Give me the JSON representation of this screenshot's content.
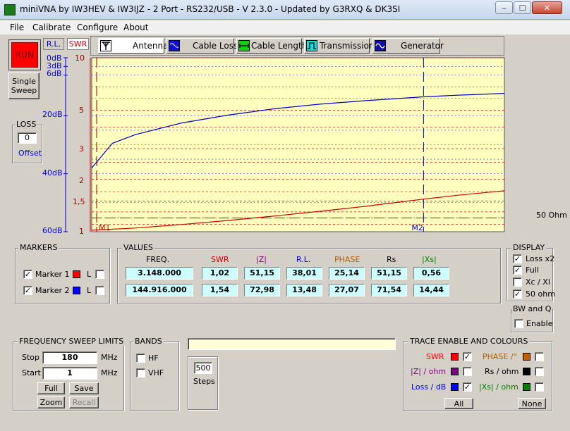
{
  "window": {
    "title": "miniVNA by IW3HEV & IW3IJZ - 2 Port - RS232/USB - V 2.3.0 - Updated by G3RXQ & DK3SI"
  },
  "menu": [
    "File",
    "Calibrate",
    "Configure",
    "About"
  ],
  "controls": {
    "run_label": "RUN",
    "single_sweep_label": "Single Sweep"
  },
  "loss": {
    "title": "LOSS",
    "value": "0",
    "offset_label": "Offset"
  },
  "axis_tabs": {
    "rl": "R.L.",
    "swr": "SWR"
  },
  "mode_tabs": [
    {
      "label": "Antenna",
      "icon": "antenna-icon"
    },
    {
      "label": "Cable Loss",
      "icon": "cable-loss-icon"
    },
    {
      "label": "Cable Length",
      "icon": "cable-length-icon"
    },
    {
      "label": "Transmission",
      "icon": "transmission-icon"
    },
    {
      "label": "Generator",
      "icon": "generator-icon"
    }
  ],
  "chart_data": {
    "type": "line",
    "rl_ticks": [
      "0dB",
      "3dB",
      "6dB",
      "20dB",
      "40dB",
      "60dB"
    ],
    "swr_ticks": [
      "10",
      "5",
      "3",
      "2",
      "1,5",
      "1"
    ],
    "impedance_label": "50 Ohm",
    "markers": [
      "M1",
      "M2"
    ],
    "x_range_mhz": [
      1,
      180
    ],
    "series": [
      {
        "name": "R.L.",
        "color": "#0000cc",
        "x": [
          1,
          10,
          20,
          40,
          60,
          80,
          100,
          120,
          144.9,
          160,
          180
        ],
        "y": [
          38.01,
          29.5,
          26.5,
          22.5,
          19.8,
          17.6,
          16.0,
          14.8,
          13.48,
          12.9,
          12.3
        ]
      },
      {
        "name": "SWR",
        "color": "#cc0000",
        "x": [
          1,
          20,
          40,
          60,
          80,
          100,
          120,
          144.9,
          160,
          180
        ],
        "y": [
          1.02,
          1.05,
          1.1,
          1.16,
          1.23,
          1.31,
          1.4,
          1.54,
          1.62,
          1.72
        ]
      }
    ]
  },
  "markers_panel": {
    "title": "MARKERS",
    "items": [
      {
        "label": "Marker 1",
        "checked": "✓",
        "color": "#ff0000",
        "l": "L"
      },
      {
        "label": "Marker 2",
        "checked": "✓",
        "color": "#0000ff",
        "l": "L"
      }
    ]
  },
  "values_panel": {
    "title": "VALUES",
    "headers": [
      "FREQ.",
      "SWR",
      "|Z|",
      "R.L.",
      "PHASE",
      "Rs",
      "|Xs|"
    ],
    "rows": [
      [
        "3.148.000",
        "1,02",
        "51,15",
        "38,01",
        "25,14",
        "51,15",
        "0,56"
      ],
      [
        "144.916.000",
        "1,54",
        "72,98",
        "13,48",
        "27,07",
        "71,54",
        "14,44"
      ]
    ]
  },
  "display_panel": {
    "title": "DISPLAY",
    "items": [
      {
        "label": "Loss x2",
        "checked": "✓"
      },
      {
        "label": "Full",
        "checked": "✓"
      },
      {
        "label": "Xc / Xl",
        "checked": ""
      },
      {
        "label": "50 ohm",
        "checked": "✓"
      }
    ]
  },
  "bwq_panel": {
    "title": "BW and Q",
    "enable_label": "Enable",
    "checked": ""
  },
  "sweep_panel": {
    "title": "FREQUENCY SWEEP LIMITS",
    "stop_label": "Stop",
    "stop_value": "180",
    "stop_unit": "MHz",
    "start_label": "Start",
    "start_value": "1",
    "start_unit": "MHz",
    "full_btn": "Full",
    "save_btn": "Save",
    "zoom_btn": "Zoom",
    "recall_btn": "Recall"
  },
  "bands_panel": {
    "title": "BANDS",
    "hf": "HF",
    "vhf": "VHF"
  },
  "steps": {
    "value": "500",
    "label": "Steps"
  },
  "trace_panel": {
    "title": "TRACE ENABLE AND COLOURS",
    "left": [
      {
        "label": "SWR",
        "color": "#ff0000",
        "label_color": "#ff0000",
        "checked": "✓"
      },
      {
        "label": "|Z| / ohm",
        "color": "#800080",
        "label_color": "#800080",
        "checked": ""
      },
      {
        "label": "Loss / dB",
        "color": "#0000ff",
        "label_color": "#0000cc",
        "checked": "✓"
      }
    ],
    "right": [
      {
        "label": "PHASE /°",
        "color": "#c06000",
        "label_color": "#b06000",
        "checked": ""
      },
      {
        "label": "Rs / ohm",
        "color": "#000000",
        "label_color": "#000000",
        "checked": ""
      },
      {
        "label": "|Xs| / ohm",
        "color": "#008000",
        "label_color": "#008000",
        "checked": ""
      }
    ],
    "all_btn": "All",
    "none_btn": "None"
  }
}
